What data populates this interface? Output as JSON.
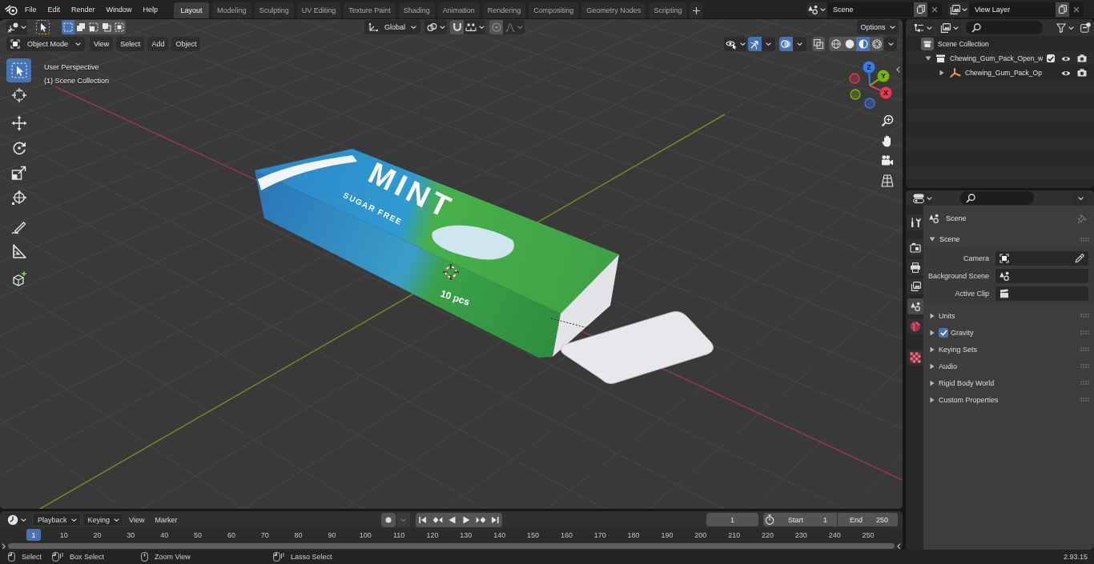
{
  "topbar": {
    "menus": [
      "File",
      "Edit",
      "Render",
      "Window",
      "Help"
    ],
    "workspaces": [
      {
        "label": "Layout",
        "selected": true
      },
      {
        "label": "Modeling",
        "selected": false
      },
      {
        "label": "Sculpting",
        "selected": false
      },
      {
        "label": "UV Editing",
        "selected": false
      },
      {
        "label": "Texture Paint",
        "selected": false
      },
      {
        "label": "Shading",
        "selected": false
      },
      {
        "label": "Animation",
        "selected": false
      },
      {
        "label": "Rendering",
        "selected": false
      },
      {
        "label": "Compositing",
        "selected": false
      },
      {
        "label": "Geometry Nodes",
        "selected": false
      },
      {
        "label": "Scripting",
        "selected": false
      }
    ],
    "scene": "Scene",
    "view_layer": "View Layer"
  },
  "viewport": {
    "header": {
      "select_modes": [
        {
          "kind": "set",
          "selected": true
        },
        {
          "kind": "extend",
          "selected": false
        },
        {
          "kind": "subtract",
          "selected": false
        },
        {
          "kind": "invert",
          "selected": false
        },
        {
          "kind": "intersect",
          "selected": false
        }
      ],
      "orientation": "Global",
      "snap": {
        "on": false
      },
      "proportional": {
        "on": false
      },
      "options": "Options",
      "mode": "Object Mode",
      "menus": [
        "View",
        "Select",
        "Add",
        "Object"
      ],
      "toggles": [
        {
          "kind": "gizmos",
          "on": true
        },
        {
          "kind": "overlays",
          "on": true
        },
        {
          "kind": "xray",
          "on": false
        }
      ],
      "shading": [
        {
          "kind": "wireframe",
          "selected": false
        },
        {
          "kind": "solid",
          "selected": false
        },
        {
          "kind": "material",
          "selected": true
        },
        {
          "kind": "rendered",
          "selected": false
        }
      ]
    },
    "info": [
      "User Perspective",
      "(1) Scene Collection"
    ],
    "tools": [
      {
        "kind": "select",
        "selected": true
      },
      {
        "kind": "cursor",
        "selected": false
      },
      {
        "kind": "move",
        "selected": false
      },
      {
        "kind": "rotate",
        "selected": false
      },
      {
        "kind": "scale",
        "selected": false
      },
      {
        "kind": "transform",
        "selected": false
      },
      {
        "kind": "annotate",
        "selected": false
      },
      {
        "kind": "measure",
        "selected": false
      },
      {
        "kind": "add_cube",
        "selected": false
      }
    ],
    "model_labels": [
      "MINT",
      "SUGAR FREE",
      "10 pcs"
    ],
    "navigation_gizmo": {
      "axes": [
        {
          "label": "Z",
          "color": "#2e7ff0"
        },
        {
          "label": "Y",
          "color": "#7ab800"
        },
        {
          "label": "X",
          "color": "#e8384f"
        }
      ]
    }
  },
  "outliner": {
    "tree": [
      {
        "name": "Scene Collection",
        "kind": "scene_collection",
        "children": [
          {
            "name": "Chewing_Gum_Pack_Open_w",
            "kind": "collection",
            "expanded": true,
            "checked": true,
            "children": [
              {
                "name": "Chewing_Gum_Pack_Op",
                "kind": "empty",
                "expanded": false
              }
            ]
          }
        ]
      }
    ]
  },
  "properties": {
    "tabs": [
      {
        "kind": "tool",
        "selected": false
      },
      {
        "kind": "render",
        "selected": false
      },
      {
        "kind": "output",
        "selected": false
      },
      {
        "kind": "view_layer",
        "selected": false
      },
      {
        "kind": "scene",
        "selected": true
      },
      {
        "kind": "world",
        "selected": false
      },
      {
        "kind": "texture",
        "selected": false
      }
    ],
    "context": "Scene",
    "panel": {
      "title": "Scene",
      "expanded": true,
      "fields": [
        {
          "label": "Camera",
          "kind": "camera"
        },
        {
          "label": "Background Scene",
          "kind": "scene"
        },
        {
          "label": "Active Clip",
          "kind": "clip"
        }
      ]
    },
    "subpanels": [
      {
        "title": "Units",
        "kind": "plain",
        "expanded": false
      },
      {
        "title": "Gravity",
        "kind": "checkbox",
        "checked": true,
        "expanded": false
      },
      {
        "title": "Keying Sets",
        "kind": "plain",
        "expanded": false
      },
      {
        "title": "Audio",
        "kind": "plain",
        "expanded": false
      },
      {
        "title": "Rigid Body World",
        "kind": "plain",
        "expanded": false
      },
      {
        "title": "Custom Properties",
        "kind": "plain",
        "expanded": false
      }
    ]
  },
  "timeline": {
    "menus": [
      {
        "label": "Playback",
        "kind": "dropdown"
      },
      {
        "label": "Keying",
        "kind": "dropdown"
      },
      {
        "label": "View",
        "kind": "plain"
      },
      {
        "label": "Marker",
        "kind": "plain"
      }
    ],
    "current_frame": "1",
    "start": {
      "label": "Start",
      "value": "1"
    },
    "end": {
      "label": "End",
      "value": "250"
    },
    "ruler": {
      "current": "1",
      "ticks": [
        "10",
        "20",
        "30",
        "40",
        "50",
        "60",
        "70",
        "80",
        "90",
        "100",
        "110",
        "120",
        "130",
        "140",
        "150",
        "160",
        "170",
        "180",
        "190",
        "200",
        "210",
        "220",
        "230",
        "240",
        "250"
      ]
    }
  },
  "status_bar": {
    "hints": [
      {
        "label": "Select",
        "kind": "click"
      },
      {
        "label": "Box Select",
        "kind": "drag"
      },
      {
        "label": "Zoom View",
        "kind": "middle"
      },
      {
        "label": "Lasso Select",
        "kind": "drag"
      }
    ],
    "version": "2.93.15"
  }
}
